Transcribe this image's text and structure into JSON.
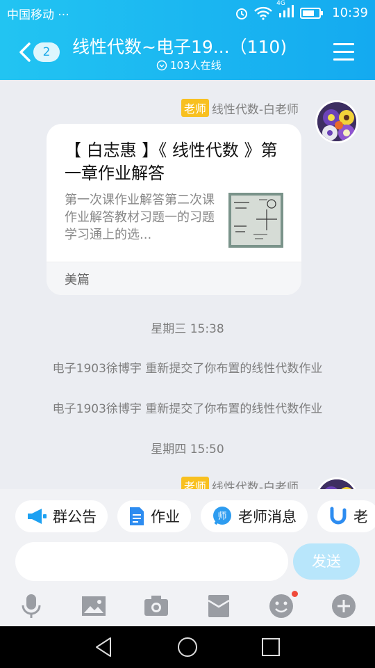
{
  "status_bar": {
    "carrier": "中国移动",
    "dots": "···",
    "network": "4G",
    "time": "10:39"
  },
  "header": {
    "unread_count": "2",
    "title": "线性代数~电子19...（110)",
    "online": "103人在线"
  },
  "messages": [
    {
      "type": "card",
      "role": "老师",
      "sender": "线性代数-白老师",
      "title": "【 白志惠 】《 线性代数 》第一章作业解答",
      "description": "第一次课作业解答第二次课作业解答教材习题一的习题学习通上的选...",
      "source": "美篇"
    },
    {
      "type": "time",
      "text": "星期三 15:38"
    },
    {
      "type": "system",
      "text": "电子1903徐博宇 重新提交了你布置的线性代数作业"
    },
    {
      "type": "system",
      "text": "电子1903徐博宇 重新提交了你布置的线性代数作业"
    },
    {
      "type": "time",
      "text": "星期四 15:50"
    },
    {
      "type": "partial",
      "role": "老师",
      "sender": "线性代数-白老师"
    }
  ],
  "quick_actions": [
    {
      "label": "群公告",
      "icon": "megaphone-icon"
    },
    {
      "label": "作业",
      "icon": "document-icon"
    },
    {
      "label": "老师消息",
      "icon": "teacher-icon"
    },
    {
      "label": "老",
      "icon": "u-icon"
    }
  ],
  "composer": {
    "placeholder": "",
    "send_label": "发送"
  },
  "toolbar": [
    "microphone-icon",
    "image-icon",
    "camera-icon",
    "red-packet-icon",
    "emoji-icon",
    "plus-icon"
  ],
  "colors": {
    "header": "#1aa9e8",
    "badge": "#f8c020",
    "send": "#b8e6fb",
    "notify_dot": "#f04a3a"
  }
}
